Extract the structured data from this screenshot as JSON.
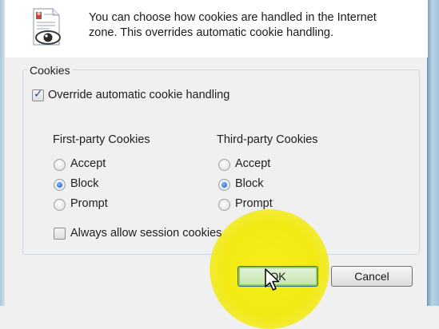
{
  "header": {
    "description": "You can choose how cookies are handled in the Internet\nzone.  This overrides automatic cookie handling.",
    "icon": "privacy-document-eye-icon"
  },
  "cookies": {
    "group_label": "Cookies",
    "override": {
      "label": "Override automatic cookie handling",
      "checked": true
    },
    "first_party": {
      "title": "First-party Cookies",
      "options": [
        "Accept",
        "Block",
        "Prompt"
      ],
      "selected": "Block"
    },
    "third_party": {
      "title": "Third-party Cookies",
      "options": [
        "Accept",
        "Block",
        "Prompt"
      ],
      "selected": "Block"
    },
    "session": {
      "label": "Always allow session cookies",
      "checked": false
    }
  },
  "buttons": {
    "ok": "OK",
    "cancel": "Cancel"
  },
  "colors": {
    "highlight": "#f2ea12",
    "ok_border": "#2c628b",
    "radio_selected": "#1f55c8"
  }
}
